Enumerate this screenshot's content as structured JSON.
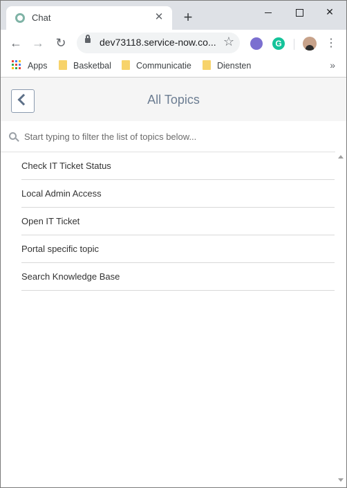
{
  "browser": {
    "tab": {
      "title": "Chat",
      "close_glyph": "✕",
      "favicon": "chat-favicon"
    },
    "new_tab_glyph": "+",
    "window_controls": {
      "close_glyph": "✕"
    },
    "toolbar": {
      "back_glyph": "←",
      "forward_glyph": "→",
      "reload_glyph": "↻",
      "url": "dev73118.service-now.co...",
      "star_glyph": "☆",
      "grammarly_letter": "G",
      "menu_glyph": "⋮"
    },
    "bookmarks": {
      "items": [
        {
          "label": "Apps",
          "icon": "apps-grid-icon"
        },
        {
          "label": "Basketbal",
          "icon": "folder-icon"
        },
        {
          "label": "Communicatie",
          "icon": "folder-icon"
        },
        {
          "label": "Diensten",
          "icon": "folder-icon"
        }
      ],
      "more_glyph": "»"
    },
    "colors": {
      "tab_strip": "#dee1e6",
      "folder": "#f7d36b"
    }
  },
  "page": {
    "title": "All Topics",
    "filter": {
      "placeholder": "Start typing to filter the list of topics below...",
      "value": ""
    },
    "topics": [
      "Check IT Ticket Status",
      "Local Admin Access",
      "Open IT Ticket",
      "Portal specific topic",
      "Search Knowledge Base"
    ],
    "colors": {
      "title": "#6c7d92",
      "header_bg": "#f5f5f5",
      "back_button_border": "#8a9aae"
    }
  }
}
